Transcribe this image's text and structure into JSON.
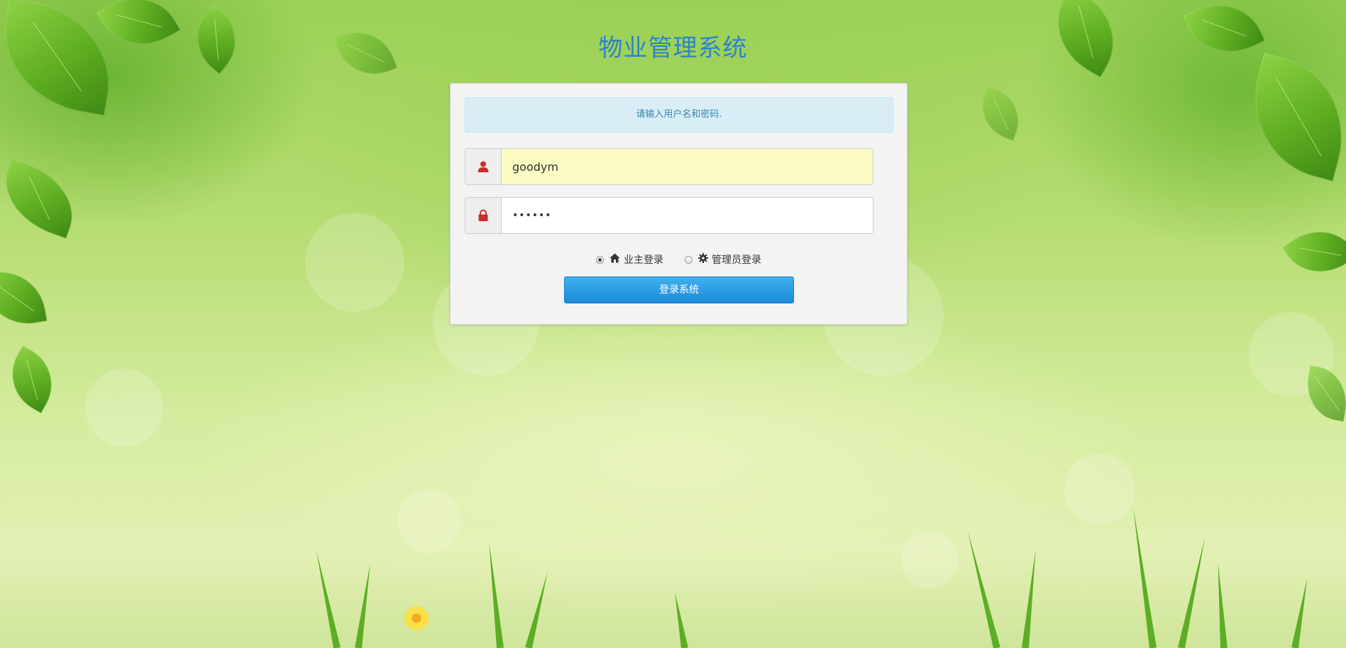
{
  "page": {
    "title": "物业管理系统"
  },
  "login": {
    "hint": "请输入用户名和密码.",
    "username_value": "goodym",
    "password_value": "••••••",
    "user_icon": "user-icon",
    "lock_icon": "lock-icon",
    "roles": [
      {
        "label": "业主登录",
        "icon": "home-icon",
        "checked": true
      },
      {
        "label": "管理员登录",
        "icon": "gear-icon",
        "checked": false
      }
    ],
    "submit_label": "登录系统"
  },
  "colors": {
    "title": "#2d84c7",
    "alert_bg": "#d9edf7",
    "alert_text": "#3a87ad",
    "icon_red": "#c9302c",
    "button": "#1c8ad8",
    "autofill_bg": "#fbfcc2"
  }
}
